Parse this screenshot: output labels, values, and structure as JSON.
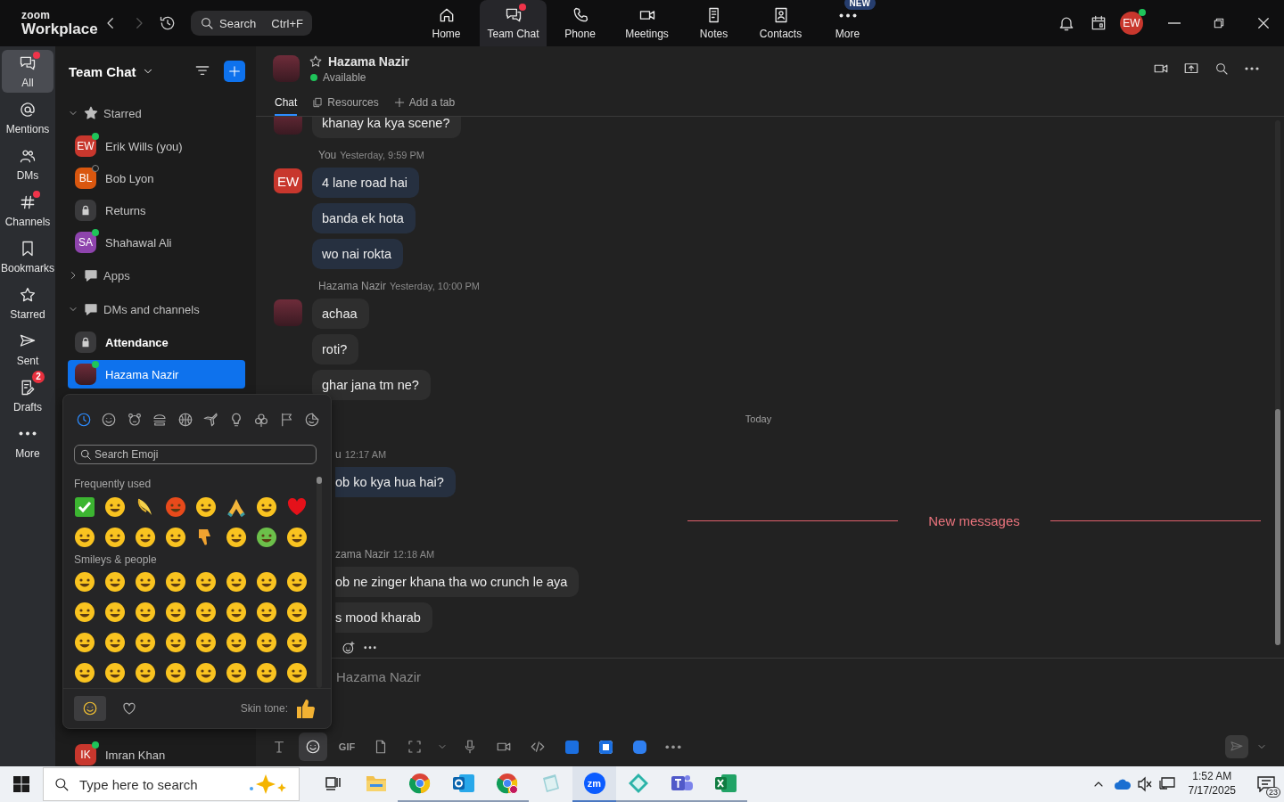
{
  "top_bar": {
    "logo_small": "zoom",
    "logo_large": "Workplace",
    "search": {
      "placeholder": "Search",
      "shortcut": "Ctrl+F"
    },
    "nav": [
      {
        "label": "Home",
        "selected": false,
        "dot": false
      },
      {
        "label": "Team Chat",
        "selected": true,
        "dot": true
      },
      {
        "label": "Phone",
        "selected": false,
        "dot": false
      },
      {
        "label": "Meetings",
        "selected": false,
        "dot": false
      },
      {
        "label": "Notes",
        "selected": false,
        "dot": false
      },
      {
        "label": "Contacts",
        "selected": false,
        "dot": false
      },
      {
        "label": "More",
        "selected": false,
        "dot": false,
        "badge": "NEW"
      }
    ],
    "user": {
      "initials": "EW",
      "online": true
    }
  },
  "rail": [
    {
      "label": "All",
      "selected": true,
      "dot": true
    },
    {
      "label": "Mentions",
      "selected": false,
      "dot": false
    },
    {
      "label": "DMs",
      "selected": false,
      "dot": false
    },
    {
      "label": "Channels",
      "selected": false,
      "dot": true
    },
    {
      "label": "Bookmarks",
      "selected": false,
      "dot": false
    },
    {
      "label": "Starred",
      "selected": false,
      "dot": false
    },
    {
      "label": "Sent",
      "selected": false,
      "dot": false
    },
    {
      "label": "Drafts",
      "selected": false,
      "dot": false,
      "badge": "2"
    },
    {
      "label": "More",
      "selected": false,
      "dot": false
    }
  ],
  "chat_list": {
    "title": "Team Chat",
    "sections": [
      {
        "label": "Starred",
        "expanded": true,
        "items": [
          {
            "name": "Erik Wills (you)",
            "kind": "initials",
            "initials": "EW",
            "color": "#c8372d",
            "online": true,
            "selected": false,
            "unread": false
          },
          {
            "name": "Bob Lyon",
            "kind": "initials",
            "initials": "BL",
            "color": "#d9570f",
            "online": false,
            "selected": false,
            "unread": false
          },
          {
            "name": "Returns",
            "kind": "lock",
            "selected": false,
            "unread": false
          },
          {
            "name": "Shahawal Ali",
            "kind": "initials",
            "initials": "SA",
            "color": "#8e44ad",
            "online": true,
            "selected": false,
            "unread": false
          }
        ]
      },
      {
        "label": "Apps",
        "expanded": false
      },
      {
        "label": "DMs and channels",
        "expanded": true,
        "items": [
          {
            "name": "Attendance",
            "kind": "lock",
            "selected": false,
            "unread": true
          },
          {
            "name": "Hazama Nazir",
            "kind": "photo",
            "online": true,
            "selected": true,
            "unread": false
          }
        ]
      }
    ],
    "bottom_items": [
      {
        "name": "Imran Khan",
        "kind": "initials",
        "initials": "IK",
        "color": "#c8372d",
        "online": true,
        "selected": false,
        "unread": false
      }
    ]
  },
  "chat": {
    "name": "Hazama Nazir",
    "status": "Available",
    "starred": false,
    "tabs": [
      {
        "label": "Chat",
        "selected": true
      },
      {
        "label": "Resources",
        "selected": false
      },
      {
        "label": "Add a tab",
        "selected": false
      }
    ],
    "groups": [
      {
        "kind": "message",
        "self": false,
        "partly_hidden": false,
        "messages": [
          "khanay ka kya scene?"
        ]
      },
      {
        "kind": "message",
        "self": true,
        "partly_hidden": false,
        "initials": "EW",
        "sender": "You",
        "time": "Yesterday, 9:59 PM",
        "messages": [
          "4 lane road hai",
          "banda ek hota",
          "wo nai rokta"
        ]
      },
      {
        "kind": "message",
        "self": false,
        "partly_hidden": false,
        "sender": "Hazama Nazir",
        "time": "Yesterday, 10:00 PM",
        "messages": [
          "achaa",
          "roti?",
          "ghar jana tm ne?"
        ]
      },
      {
        "kind": "divider",
        "label": "Today",
        "highlight": false
      },
      {
        "kind": "message",
        "self": true,
        "partly_hidden": true,
        "sender": "u",
        "time": "12:17 AM",
        "messages": [
          "ob ko kya hua hai?"
        ]
      },
      {
        "kind": "divider",
        "label": "New messages",
        "highlight": true
      },
      {
        "kind": "message",
        "self": false,
        "partly_hidden": true,
        "sender": "zama Nazir",
        "time": "12:18 AM",
        "messages": [
          "ob ne zinger khana tha wo crunch le aya",
          "s mood kharab"
        ],
        "reactions_bar": true
      }
    ],
    "composer": {
      "placeholder": "Hazama Nazir",
      "gif_label": "GIF",
      "send_enabled": false
    }
  },
  "emoji_picker": {
    "categories": [
      {
        "selected": true
      },
      {
        "selected": false
      },
      {
        "selected": false
      },
      {
        "selected": false
      },
      {
        "selected": false
      },
      {
        "selected": false
      },
      {
        "selected": false
      },
      {
        "selected": false
      },
      {
        "selected": false
      },
      {
        "selected": false
      }
    ],
    "search_placeholder": "Search Emoji",
    "sections": [
      {
        "title": "Frequently used",
        "kind": "frequent"
      },
      {
        "title": "Smileys & people",
        "kind": "smileys"
      }
    ],
    "tabs": [
      {
        "selected": true
      },
      {
        "selected": false
      }
    ],
    "skin_tone_label": "Skin tone:"
  },
  "taskbar": {
    "search_placeholder": "Type here to search",
    "apps": [
      {
        "running": false,
        "focused": false
      },
      {
        "running": false,
        "focused": false
      },
      {
        "running": true,
        "focused": false
      },
      {
        "running": true,
        "focused": false
      },
      {
        "running": true,
        "focused": false
      },
      {
        "running": false,
        "focused": false
      },
      {
        "running": true,
        "focused": true
      },
      {
        "running": true,
        "focused": false
      },
      {
        "running": true,
        "focused": false
      },
      {
        "running": true,
        "focused": false
      }
    ],
    "zm_label": "zm",
    "time": "1:52 AM",
    "date": "7/17/2025",
    "notifications": "23"
  }
}
